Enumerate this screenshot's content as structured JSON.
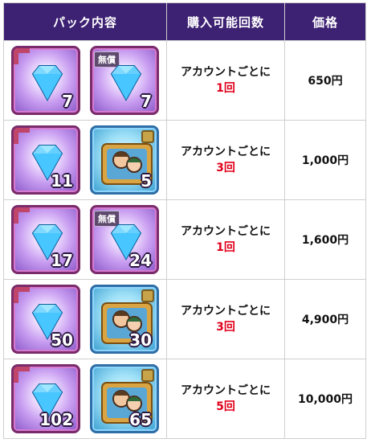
{
  "header": {
    "contents": "パック内容",
    "limit": "購入可能回数",
    "price": "価格"
  },
  "rows": [
    {
      "item1": {
        "count": "7",
        "kind": "gem"
      },
      "item2": {
        "count": "7",
        "kind": "gem",
        "badge": "無償"
      },
      "limit_text": "アカウントごとに",
      "times": "1回",
      "price": "650円"
    },
    {
      "item1": {
        "count": "11",
        "kind": "gem"
      },
      "item2": {
        "count": "5",
        "kind": "character"
      },
      "limit_text": "アカウントごとに",
      "times": "3回",
      "price": "1,000円"
    },
    {
      "item1": {
        "count": "17",
        "kind": "gem"
      },
      "item2": {
        "count": "24",
        "kind": "gem",
        "badge": "無償"
      },
      "limit_text": "アカウントごとに",
      "times": "1回",
      "price": "1,600円"
    },
    {
      "item1": {
        "count": "50",
        "kind": "gem"
      },
      "item2": {
        "count": "30",
        "kind": "character"
      },
      "limit_text": "アカウントごとに",
      "times": "3回",
      "price": "4,900円"
    },
    {
      "item1": {
        "count": "102",
        "kind": "gem"
      },
      "item2": {
        "count": "65",
        "kind": "character"
      },
      "limit_text": "アカウントごとに",
      "times": "5回",
      "price": "10,000円"
    }
  ],
  "colors": {
    "header_bg": "#3d2173",
    "times_red": "#e0001b"
  },
  "icons": [
    "diamond-gem-icon",
    "character-ticket-icon"
  ]
}
